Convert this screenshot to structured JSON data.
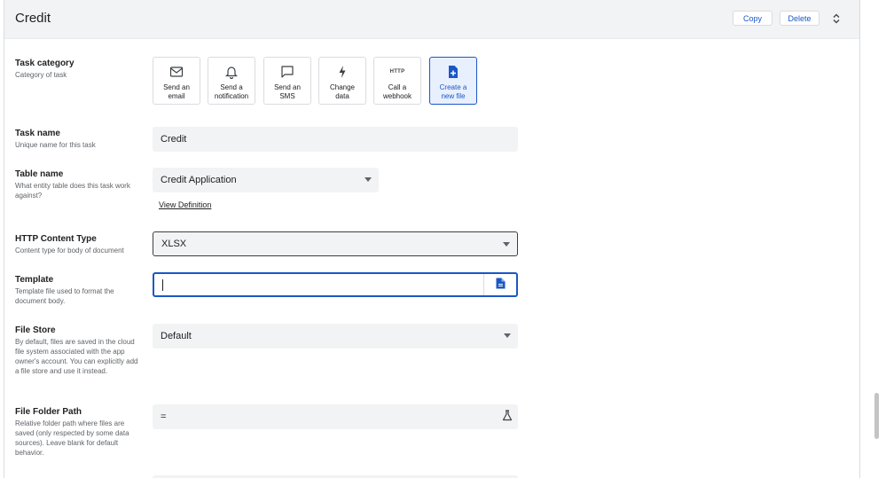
{
  "header": {
    "title": "Credit",
    "copy_label": "Copy",
    "delete_label": "Delete"
  },
  "task_category": {
    "title": "Task category",
    "description": "Category of task",
    "options": [
      {
        "label": "Send an\nemail",
        "icon": "mail-icon",
        "selected": false
      },
      {
        "label": "Send a\nnotification",
        "icon": "bell-icon",
        "selected": false
      },
      {
        "label": "Send an\nSMS",
        "icon": "message-icon",
        "selected": false
      },
      {
        "label": "Change\ndata",
        "icon": "bolt-icon",
        "selected": false
      },
      {
        "label": "Call a\nwebhook",
        "icon": "http-icon",
        "icon_text": "HTTP",
        "selected": false
      },
      {
        "label": "Create a\nnew file",
        "icon": "new-file-icon",
        "selected": true
      }
    ]
  },
  "task_name": {
    "title": "Task name",
    "description": "Unique name for this task",
    "value": "Credit"
  },
  "table_name": {
    "title": "Table name",
    "description": "What entity table does this task work against?",
    "value": "Credit Application",
    "link": "View Definition"
  },
  "content_type": {
    "title": "HTTP Content Type",
    "description": "Content type for body of document",
    "value": "XLSX"
  },
  "template": {
    "title": "Template",
    "description": "Template file used to format the document body.",
    "value": ""
  },
  "file_store": {
    "title": "File Store",
    "description": "By default, files are saved in the cloud file system associated with the app owner's account. You can explicitly add a file store and use it instead.",
    "value": "Default"
  },
  "folder_path": {
    "title": "File Folder Path",
    "description": "Relative folder path where files are saved (only respected by some data sources). Leave blank for default behavior.",
    "value": "="
  },
  "colors": {
    "accent": "#1a57c6",
    "selected_bg": "#e8f0fe",
    "field_bg": "#f1f3f4"
  }
}
